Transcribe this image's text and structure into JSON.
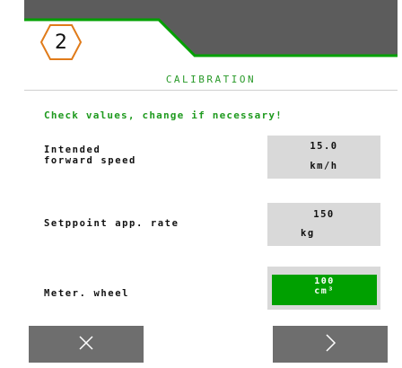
{
  "step": {
    "number": "2"
  },
  "title": "CALIBRATION",
  "instruction": "Check values, change if necessary!",
  "rows": [
    {
      "label": "Intended\nforward speed",
      "value": "15.0",
      "unit": "km/h"
    },
    {
      "label": "Setppoint app. rate",
      "value": "150",
      "unit": "kg"
    },
    {
      "label": "Meter. wheel",
      "value": "100",
      "unit": "cm³"
    }
  ],
  "buttons": {
    "cancel_icon": "close-icon",
    "next_icon": "chevron-right-icon"
  },
  "colors": {
    "header_gray": "#5c5c5c",
    "accent_green": "#00a000",
    "value_bg": "#d9d9d9",
    "button_gray": "#6e6e6e",
    "badge_orange": "#e07b1a"
  }
}
